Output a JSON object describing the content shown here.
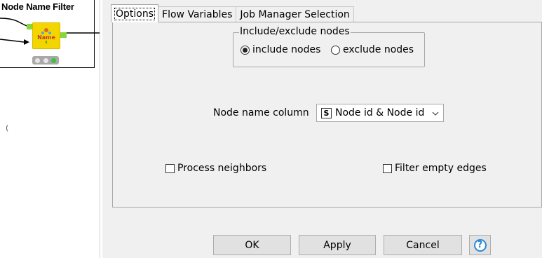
{
  "workflow": {
    "node_title": "Node Name Filter",
    "node_icon_text": "Name",
    "stray_mark": "(",
    "status_lights": [
      "off",
      "off",
      "on"
    ],
    "colors": {
      "node_body": "#f3d600",
      "port": "#88d63a",
      "status_on": "#3cc43c"
    }
  },
  "dialog": {
    "tabs": [
      {
        "label": "Options",
        "active": true
      },
      {
        "label": "Flow Variables",
        "active": false
      },
      {
        "label": "Job Manager Selection",
        "active": false
      }
    ],
    "include_group": {
      "legend": "Include/exclude nodes",
      "options": [
        {
          "label": "include nodes",
          "checked": true
        },
        {
          "label": "exclude nodes",
          "checked": false
        }
      ]
    },
    "column": {
      "label": "Node name column",
      "type_badge": "S",
      "value": "Node id & Node id",
      "chevron_icon": "chevron-down-icon"
    },
    "checkboxes": [
      {
        "label": "Process neighbors",
        "checked": false
      },
      {
        "label": "Filter empty edges",
        "checked": false
      }
    ],
    "buttons": {
      "ok": "OK",
      "apply": "Apply",
      "cancel": "Cancel",
      "help": "?"
    }
  }
}
